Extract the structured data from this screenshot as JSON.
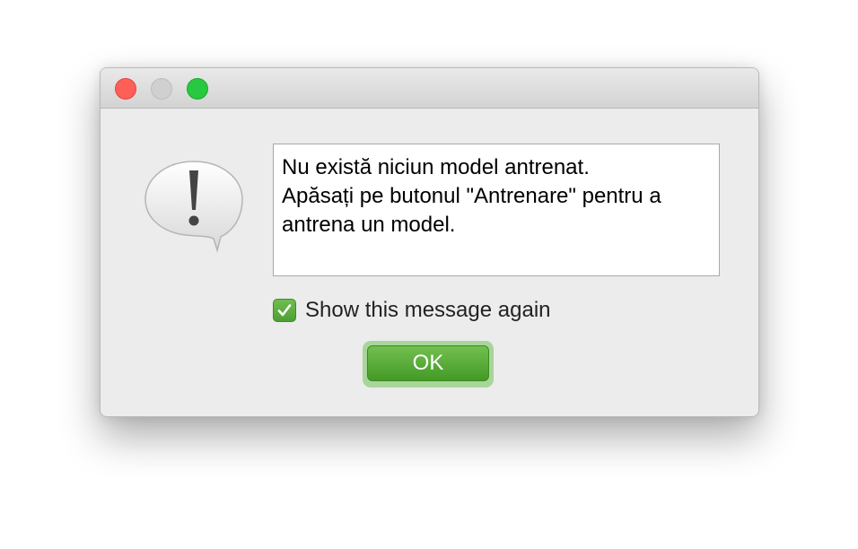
{
  "dialog": {
    "message": "Nu există niciun model antrenat.\nApăsați pe butonul \"Antrenare\" pentru a antrena un model.",
    "checkbox": {
      "label": "Show this message again",
      "checked": true
    },
    "ok_label": "OK",
    "icon": "alert-exclamation-icon"
  },
  "colors": {
    "close": "#fe5f57",
    "minimize": "#d0d0d0",
    "maximize": "#28c840",
    "accent_green": "#4e9f33"
  }
}
